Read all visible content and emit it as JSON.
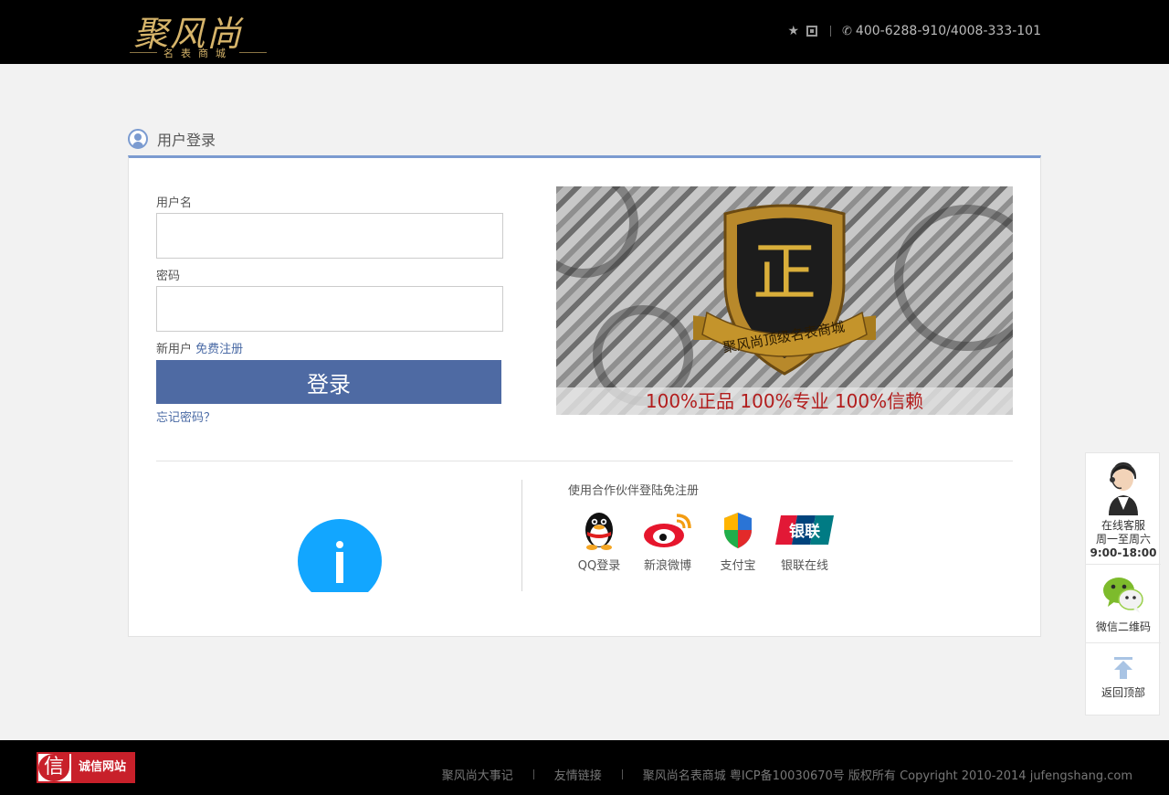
{
  "header": {
    "logo_main": "聚风尚",
    "logo_sub": "名表商城",
    "phone": "400-6288-910/4008-333-101"
  },
  "login": {
    "title": "用户登录",
    "username_label": "用户名",
    "username_value": "",
    "password_label": "密码",
    "password_value": "",
    "new_user_text": "新用户",
    "register_link": "免费注册",
    "login_button": "登录",
    "forgot_link": "忘记密码？"
  },
  "banner": {
    "shield_char": "正",
    "ribbon_text": "聚风尚顶级名表商城",
    "slogan": "100%正品  100%专业  100%信赖"
  },
  "partners": {
    "title": "使用合作伙伴登陆免注册",
    "items": [
      {
        "label": "QQ登录",
        "icon": "qq-icon"
      },
      {
        "label": "新浪微博",
        "icon": "weibo-icon"
      },
      {
        "label": "支付宝",
        "icon": "alipay-icon"
      },
      {
        "label": "银联在线",
        "icon": "unionpay-icon"
      }
    ],
    "unionpay_glyph": "银联"
  },
  "side": {
    "service_label": "在线客服",
    "service_days": "周一至周六",
    "service_hours": "9:00-18:00",
    "wechat_label": "微信二维码",
    "top_label": "返回顶部"
  },
  "footer": {
    "trust_mark": "信",
    "trust_label": "诚信网站",
    "links": [
      "聚风尚大事记",
      "友情链接"
    ],
    "copyright": "聚风尚名表商城 粤ICP备10030670号 版权所有 Copyright 2010-2014 jufengshang.com"
  },
  "colors": {
    "accent": "#4e6aa3",
    "link": "#4a6aa5",
    "gold": "#d6b46a",
    "info_blue": "#12a6ff",
    "slogan_red": "#b21d1d"
  }
}
